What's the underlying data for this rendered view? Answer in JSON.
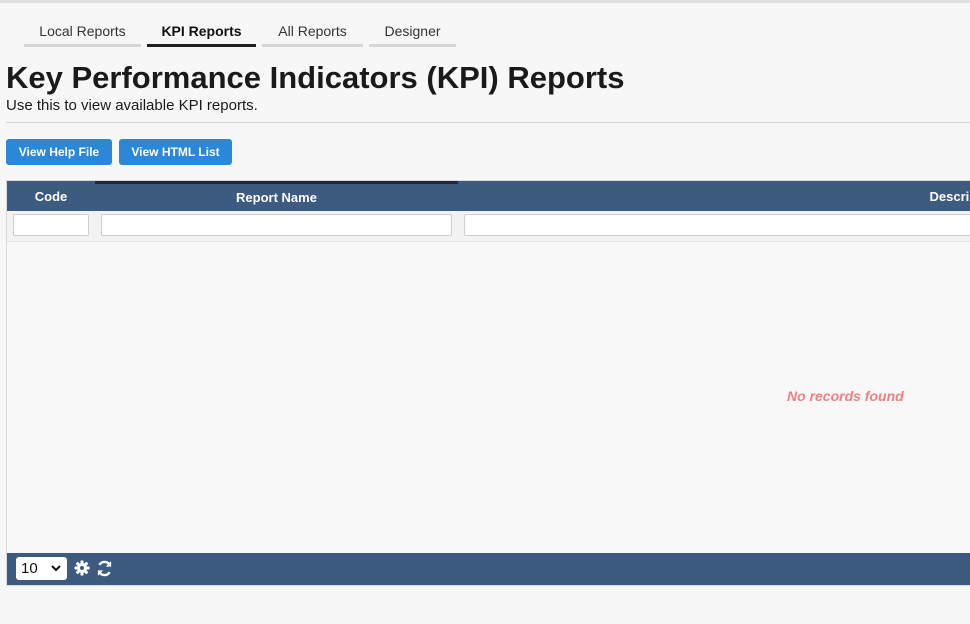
{
  "tabs": [
    {
      "label": "Local Reports",
      "active": false
    },
    {
      "label": "KPI Reports",
      "active": true
    },
    {
      "label": "All Reports",
      "active": false
    },
    {
      "label": "Designer",
      "active": false
    }
  ],
  "page": {
    "title": "Key Performance Indicators (KPI) Reports",
    "subtitle": "Use this to view available KPI reports."
  },
  "buttons": {
    "help": "View Help File",
    "html_list": "View HTML List"
  },
  "grid": {
    "columns": {
      "code": "Code",
      "name": "Report Name",
      "description": "Description"
    },
    "empty_message": "No records found",
    "page_size": "10",
    "icons": {
      "settings": "gear-icon",
      "refresh": "refresh-icon"
    }
  },
  "colors": {
    "accent": "#2b88d8",
    "header_bg": "#3d5a80",
    "empty_text": "#f08080"
  }
}
